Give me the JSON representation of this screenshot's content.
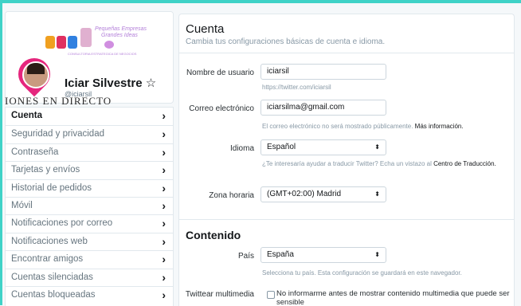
{
  "profile": {
    "banner_line1": "Pequeñas Empresas",
    "banner_line2": "Grandes Ideas",
    "banner_line3": "CONSULTORIA ESTRATEGICA DE NEGOCIOS",
    "name": "Iciar Silvestre",
    "star": "☆",
    "handle": "@iciarsil",
    "live_text": "IONES EN DIRECTO"
  },
  "sidebar": {
    "items": [
      {
        "label": "Cuenta",
        "active": true
      },
      {
        "label": "Seguridad y privacidad"
      },
      {
        "label": "Contraseña"
      },
      {
        "label": "Tarjetas y envíos"
      },
      {
        "label": "Historial de pedidos"
      },
      {
        "label": "Móvil"
      },
      {
        "label": "Notificaciones por correo"
      },
      {
        "label": "Notificaciones web"
      },
      {
        "label": "Encontrar amigos"
      },
      {
        "label": "Cuentas silenciadas"
      },
      {
        "label": "Cuentas bloqueadas"
      }
    ],
    "chevron": "›"
  },
  "account": {
    "title": "Cuenta",
    "subtitle": "Cambia tus configuraciones básicas de cuenta e idioma.",
    "username_label": "Nombre de usuario",
    "username_value": "iciarsil",
    "username_hint": "https://twitter.com/iciarsil",
    "email_label": "Correo electrónico",
    "email_value": "iciarsilma@gmail.com",
    "email_hint": "El correo electrónico no será mostrado públicamente.",
    "email_hint_link": "Más información.",
    "language_label": "Idioma",
    "language_value": "Español",
    "language_hint": "¿Te interesaría ayudar a traducir Twitter? Echa un vistazo al",
    "language_hint_link": "Centro de Traducción.",
    "timezone_label": "Zona horaria",
    "timezone_value": "(GMT+02:00) Madrid"
  },
  "content": {
    "title": "Contenido",
    "country_label": "País",
    "country_value": "España",
    "country_hint": "Selecciona tu país. Esta configuración se guardará en este navegador.",
    "media_label": "Twittear multimedia",
    "media_checkbox_label": "No informarme antes de mostrar contenido multimedia que puede ser sensible"
  },
  "select_arrows": "⬍",
  "colors": {
    "accent_frame": "#3fd2c7",
    "pin": "#e5267d",
    "link_text": "#14171a"
  }
}
